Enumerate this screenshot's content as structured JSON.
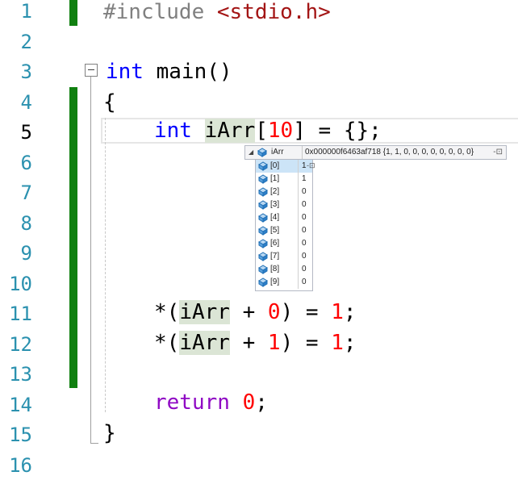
{
  "gutter": [
    "1",
    "2",
    "3",
    "4",
    "5",
    "6",
    "7",
    "8",
    "9",
    "10",
    "11",
    "12",
    "13",
    "14",
    "15",
    "16"
  ],
  "code": {
    "l1_directive": "#include",
    "l1_header": "<stdio.h>",
    "l3_type": "int",
    "l3_name": "main()",
    "l4_brace": "{",
    "l5_type": "int",
    "l5_var": "iArr",
    "l5_bracket_open": "[",
    "l5_size": "10",
    "l5_rest": "] = {};",
    "l11_prefix": "*(",
    "l11_var": "iArr",
    "l11_plus": " + ",
    "l11_offset": "0",
    "l11_mid": ") = ",
    "l11_value": "1",
    "l11_end": ";",
    "l12_prefix": "*(",
    "l12_var": "iArr",
    "l12_plus": " + ",
    "l12_offset": "1",
    "l12_mid": ") = ",
    "l12_value": "1",
    "l12_end": ";",
    "l14_kw": "return",
    "l14_space": " ",
    "l14_value": "0",
    "l14_end": ";",
    "l15_brace": "}"
  },
  "datatip": {
    "expander": "◢",
    "name": "iArr",
    "value": "0x000000f6463af718 {1, 1, 0, 0, 0, 0, 0, 0, 0, 0}",
    "pin": "-⊡",
    "elements": [
      {
        "index": "[0]",
        "value": "1",
        "pin": "-⊡"
      },
      {
        "index": "[1]",
        "value": "1",
        "pin": ""
      },
      {
        "index": "[2]",
        "value": "0",
        "pin": ""
      },
      {
        "index": "[3]",
        "value": "0",
        "pin": ""
      },
      {
        "index": "[4]",
        "value": "0",
        "pin": ""
      },
      {
        "index": "[5]",
        "value": "0",
        "pin": ""
      },
      {
        "index": "[6]",
        "value": "0",
        "pin": ""
      },
      {
        "index": "[7]",
        "value": "0",
        "pin": ""
      },
      {
        "index": "[8]",
        "value": "0",
        "pin": ""
      },
      {
        "index": "[9]",
        "value": "0",
        "pin": ""
      }
    ]
  },
  "icons": {
    "variable": "variable-cube-icon",
    "expander": "expand-triangle-icon",
    "pin": "pin-icon",
    "fold": "collapse-minus-icon"
  },
  "colors": {
    "line_number": "#2b91af",
    "keyword": "#0000ff",
    "string": "#a31515",
    "number": "#ff0000",
    "control_keyword": "#8f08c4",
    "change_bar": "#108010",
    "highlight": "#dbe5d5"
  }
}
